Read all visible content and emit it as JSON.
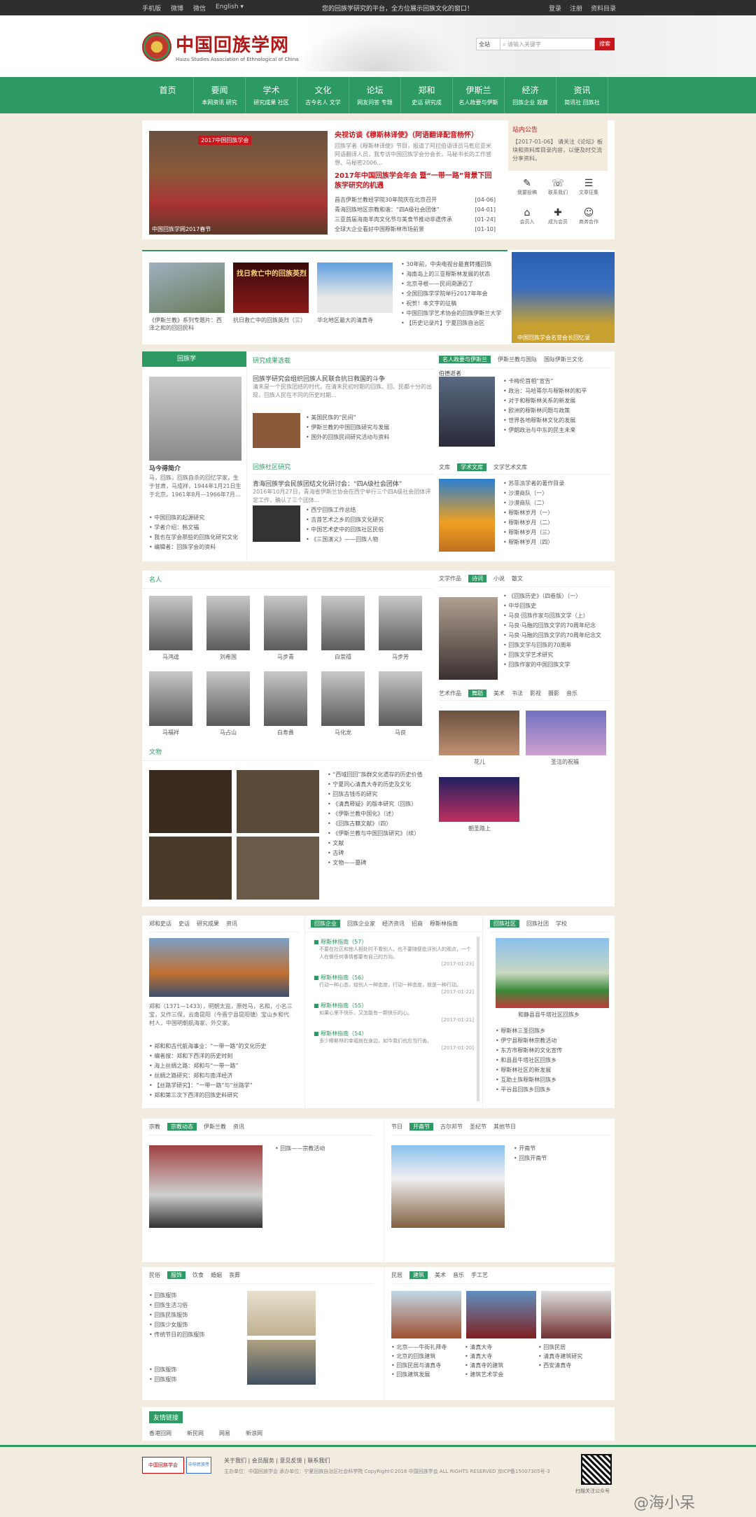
{
  "topbar": {
    "mobile": "手机版",
    "weibo": "微博",
    "weixin": "微信",
    "lang": "English ▾",
    "slogan": "您的回族学研究的平台，全方位展示回族文化的窗口！",
    "login": "登录",
    "register": "注册",
    "service": "资料目录"
  },
  "logo": {
    "title": "中国回族学网",
    "subtitle": "Huizu Studies Association of Ethnological of China"
  },
  "search": {
    "select": "全站",
    "placeholder": "请输入关键字",
    "button": "搜索"
  },
  "nav": [
    {
      "m": "首页",
      "s": ""
    },
    {
      "m": "要闻",
      "s": "本网资讯  研究"
    },
    {
      "m": "学术",
      "s": "研究成果  社区"
    },
    {
      "m": "文化",
      "s": "古今名人  文学"
    },
    {
      "m": "论坛",
      "s": "网友问答  专题"
    },
    {
      "m": "郑和",
      "s": "史话  研究成"
    },
    {
      "m": "伊斯兰",
      "s": "名人政要与伊斯"
    },
    {
      "m": "经济",
      "s": "回族企业  观察"
    },
    {
      "m": "资讯",
      "s": "简讯社  回族社"
    }
  ],
  "hero": {
    "caption": "中国回族学网2017春节",
    "badge": "2017中国回族学会",
    "h1": "央视访谈《穆斯林译使》（阿语翻译配音杨怀）",
    "h1desc": "回族学者《穆斯林译使》节目，报道了阿拉伯语译员马乾尼亚米阿语翻译人员，我专访中国回族学会分会长，马秘书长的工作感想、马秘密2006...",
    "h2": "2017年中国回族学会年会 暨“一带一路”背景下回族学研究的机遇",
    "news": [
      {
        "t": "昌吉伊斯兰教经学院30年院庆在北京召开",
        "d": "[04-06]"
      },
      {
        "t": "青海回族地区宗教和谐：“四A级社会团体”",
        "d": "[04-01]"
      },
      {
        "t": "三亚首届海南羊肉文化节与美食节推动非遗传承",
        "d": "[01-24]"
      },
      {
        "t": "全球大企业看好中国穆斯林市场前景",
        "d": "[01-10]"
      }
    ]
  },
  "notice": {
    "title": "站内公告",
    "text": "【2017-01-06】 请关注《论坛》板块和资料库目录内容，以便及时交流分享资料。"
  },
  "quick": [
    {
      "g": "✎",
      "t": "我要投稿"
    },
    {
      "g": "☏",
      "t": "联系我们"
    },
    {
      "g": "☰",
      "t": "文章征集"
    },
    {
      "g": "⌂",
      "t": "会员入"
    },
    {
      "g": "✚",
      "t": "成为会员"
    },
    {
      "g": "☺",
      "t": "商务合作"
    }
  ],
  "row2": {
    "p1": "《伊斯兰教》系列专题片：西泽之和的回回民科",
    "p2": "抗日救亡中的回族英烈（三）",
    "p3": "华北地区最大的清真寺",
    "banner": "中国回族学会名誉会长回忆录",
    "title2": "找日救亡中的回族英烈",
    "list": [
      "30年前，中央电视台最直转播回族",
      "海南岛上的三亚穆斯林发展的状态",
      "北京寻根——民间溯源迈了",
      "全国回族学学院举行2017年年会",
      "祝贺！本文字的征稿",
      "中国回族学艺术协会的回族伊斯兰大学",
      "【历史记录片】宁夏回族自治区"
    ]
  },
  "scholar": {
    "tab": "回族学",
    "name": "马今得简介",
    "desc": "马，回族，回族自杀的回忆学家，生于甘肃，马成祥，1944年1月21日生于北京。1961年8月—1966年7月...",
    "list": [
      "中国回族的起源研究",
      "学者介绍：韩文福",
      "我也在学会那些的回族化研究文化",
      "编辑者：回族学会的资料"
    ]
  },
  "research": {
    "tab": "研究成果选载",
    "t1": "回族学研究会组织回族人民联合抗日救国的斗争",
    "d1": "清末是一个民族团结的时代，在清末民初时期的回族、回、民都十分的出现，回族人民在不同的历史时期...",
    "list1": [
      "美国民族的“民间”",
      "伊斯兰教的中国回族研究与发展",
      "国外的回族民间研究活动与资料"
    ],
    "t2": "青海回族学会民族团结文化研讨会：“四A级社会团体”",
    "d2": "2016年10月27日，青海省伊斯兰协会在西宁举行三个四A级社会团体评定工作，确认了三个团体...",
    "list2": [
      "西宁回族工作总结",
      "吉首艺术之乡的回族文化研究",
      "中国艺术史中的回族社区民俗",
      "《三国演义》——回族人物"
    ]
  },
  "politics": {
    "tab": "名人政要与伊斯兰",
    "tab2": "伊斯兰教与国际",
    "tab3": "国际伊斯兰文化",
    "name": "伯德逝者",
    "list": [
      "卡梅伦首相“宣告”",
      "政治：马哈蒂尔与穆斯林的和平",
      "对于和穆斯林关系的新发展",
      "欧洲的穆斯林问题与政策",
      "世界各地穆斯林文化的发展",
      "伊朗政治与中东的民主未来"
    ]
  },
  "lit": {
    "tab": "文库",
    "tab2": "学术文库",
    "tab3": "文学艺术文库",
    "list": [
      "苏菲派学者的著作目录",
      "沙漠商队（一）",
      "沙漠商队（二）",
      "穆斯林岁月（一）",
      "穆斯林岁月（二）",
      "穆斯林岁月（三）",
      "穆斯林岁月（四）"
    ]
  },
  "people": {
    "tab": "名人",
    "names": [
      "马鸿逵",
      "刘希国",
      "马步青",
      "白崇禧",
      "马步芳",
      "马福祥",
      "马占山",
      "白寿彝",
      "马化龙",
      "马良"
    ]
  },
  "relics": {
    "tab": "文物",
    "list": [
      "“西域回回”族群文化遗存的历史价值",
      "宁夏同心清真大寺的历史及文化",
      "回族古钱币的研究",
      "《清真释疑》的版本研究（回族）",
      "《伊斯兰教中国化》（述）",
      "《回族古籍文献》（四）",
      "《伊斯兰教与中国回族研究》（续）",
      "文献",
      "古碑",
      "文物——墓碑"
    ]
  },
  "literature": {
    "tab": "文学作品",
    "tab2": "诗词",
    "tab3": "小说",
    "tab4": "散文",
    "list": [
      "《回族历史》（四卷版）（一）",
      "中华回族史",
      "马良·回族作家与回族文学（上）",
      "马良·马融的回族文学的70周年纪念",
      "马良·马融的回族文学的70周年纪念文",
      "回族文学与回族的70周年",
      "回族文学艺术研究",
      "回族作家的中国回族文学"
    ]
  },
  "art": {
    "tab": "艺术作品",
    "tabs": [
      "舞蹈",
      "美术",
      "书法",
      "影视",
      "摄影",
      "音乐"
    ],
    "c1": "花儿",
    "c2": "圣洁的祝福",
    "c3": "朝圣路上"
  },
  "zhenghe": {
    "tab": "郑和史话",
    "tab2": "史话",
    "tab3": "研究成果",
    "tab4": "资讯",
    "desc": "郑和（1371—1433），明朝太监，原姓马，名和，小名三宝，又作三保，云南昆阳（今晋宁县昆阳镇）宝山乡和代村人，中国明朝航海家、外交家。",
    "list": [
      "郑和和古代航海事业：“一带一路”的文化历史",
      "编者按：郑和下西洋的历史时刻",
      "海上丝绸之路：郑和与“一带一路”",
      "丝绸之路研究：郑和与南洋经济",
      "【丝路学研究】：“一带一路”与“丝路学”",
      "郑和第三次下西洋的回族史料研究"
    ]
  },
  "enterprise": {
    "tab": "回族企业",
    "tab2": "回族企业家",
    "tab3": "经济资讯",
    "tab4": "招商",
    "tab5": "穆斯林指南",
    "items": [
      {
        "t": "穆斯林指南（57）",
        "d": "不要在社区和他人相处时不看别人，也不要随便批评别人的观点，一个人在做任何事情都要有自己的方向。",
        "date": "[2017-01-23]"
      },
      {
        "t": "穆斯林指南（56）",
        "d": "行动一种心态，给别人一种态度，行动一种态度，就是一种行动。",
        "date": "[2017-01-22]"
      },
      {
        "t": "穆斯林指南（55）",
        "d": "如果心里不快乐，又怎能有一颗快乐的心。",
        "date": "[2017-01-21]"
      },
      {
        "t": "穆斯林指南（54）",
        "d": "多少穆斯林的幸福就在身边，如今我们也应当行善。",
        "date": "[2017-01-20]"
      }
    ]
  },
  "community": {
    "tab": "回族社区",
    "tab2": "回族社团",
    "tab3": "学校",
    "caption": "和静县县牛塔社区回族乡",
    "list": [
      "穆斯林三圣回族乡",
      "伊宁县穆斯林宗教活动",
      "东方市穆斯林的文化宣传",
      "和县县牛塔社区回族乡",
      "穆斯林社区的新发展",
      "互助土族穆斯林回族乡",
      "平谷县回族乡回族乡"
    ]
  },
  "religion": {
    "tab": "宗教",
    "tab2": "宗教动态",
    "tab3": "伊斯兰教",
    "tab4": "资讯",
    "list": [
      "回族——宗教活动"
    ]
  },
  "festival": {
    "tab": "节日",
    "tab2": "开斋节",
    "tab3": "古尔邦节",
    "tab4": "圣纪节",
    "tab5": "其他节日",
    "list": [
      "开斋节",
      "回族开斋节"
    ]
  },
  "custom": {
    "tab": "民俗",
    "tabs": [
      "服饰",
      "饮食",
      "婚姻",
      "丧葬"
    ],
    "list": [
      "回族服饰",
      "回族生活习俗",
      "回族民族服饰",
      "回族少女服饰",
      "传统节日的回族服饰"
    ],
    "list2": [
      "回族服饰",
      "回族服饰"
    ]
  },
  "architecture": {
    "tab": "民居",
    "tabs": [
      "建筑",
      "美术",
      "音乐",
      "手工艺"
    ],
    "list": [
      "北京——牛街礼拜寺",
      "清真大寺",
      "回族民居",
      "北京的回族建筑",
      "清真大寺",
      "清真寺建筑研究",
      "回族民居与清真寺",
      "清真寺的建筑",
      "西安清真寺",
      "回族建筑发展",
      "建筑艺术学会"
    ]
  },
  "links": {
    "tab": "友情链接",
    "items": [
      "香港回网",
      "新民网",
      "网易",
      "新浪网"
    ]
  },
  "footer": {
    "links": "关于我们 | 会员服务 | 意见反馈 | 联系我们",
    "line2": "主办单位：中国回族学会  承办单位：宁夏回族自治区社会科学院  CopyRight©2016 中国回族学会 ALL RIGHTS RESERVED  京ICP备15007305号-3",
    "badge1": "中国回族学会",
    "badge2": "中华民族传承",
    "qr": "扫描关注公众号",
    "watermark": "@海小呆"
  }
}
